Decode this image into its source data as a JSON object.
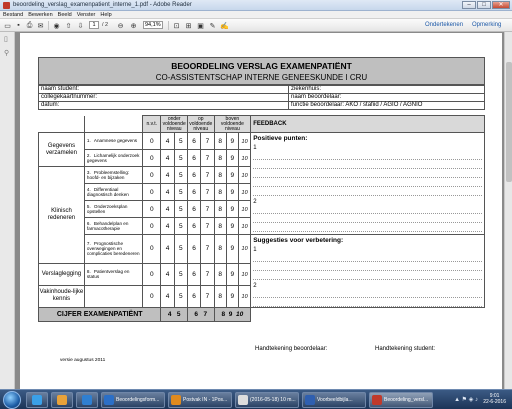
{
  "window": {
    "title": "beoordeling_verslag_examenpatient_interne_1.pdf - Adobe Reader",
    "minimize": "–",
    "maximize": "□",
    "close": "✕"
  },
  "menu": [
    "Bestand",
    "Bewerken",
    "Beeld",
    "Venster",
    "Help"
  ],
  "toolbar": {
    "page_current": "1",
    "page_total": "/ 2",
    "zoom": "94,1%",
    "sign_link": "Ondertekenen",
    "comment_link": "Opmerking"
  },
  "doc": {
    "title": "BEOORDELING VERSLAG EXAMENPATIËNT",
    "subtitle": "CO-ASSISTENTSCHAP INTERNE GENEESKUNDE I CRU",
    "info": [
      {
        "left": "naam student:",
        "right": "ziekenhuis:"
      },
      {
        "left": "collegekaartnummer:",
        "right": "naam beoordelaar:"
      },
      {
        "left": "datum:",
        "right": "functie beoordelaar: AKO / stafiid / AGIO / AGNIO"
      }
    ],
    "headers": {
      "nvt": "n.v.t.",
      "onder": "onder voldoende niveau",
      "op": "op voldoende niveau",
      "boven": "boven voldoende niveau",
      "feedback": "FEEDBACK"
    },
    "score_nvt": "0",
    "score_onder": [
      "4",
      "5"
    ],
    "score_op": [
      "6",
      "7"
    ],
    "score_boven": [
      "8",
      "9",
      "10"
    ],
    "categories": [
      {
        "name": "Gegevens verzamelen",
        "items": [
          {
            "num": "1.",
            "text": "Anamnese gegevens"
          },
          {
            "num": "2.",
            "text": "Lichamelijk onderzoek gegevens"
          }
        ]
      },
      {
        "name": "Klinisch redeneren",
        "items": [
          {
            "num": "3.",
            "text": "Probleemstelling: hoofd- en bijzaken"
          },
          {
            "num": "4.",
            "text": "Differentiaal diagnostisch denken"
          },
          {
            "num": "5.",
            "text": "Onderzoeksplan opstellen"
          },
          {
            "num": "6.",
            "text": "Behandelplan en farmacotherapie"
          },
          {
            "num": "7.",
            "text": "Prognostische overwegingen en complicaties beredeneren"
          }
        ]
      },
      {
        "name": "Verslaglegging",
        "items": [
          {
            "num": "8.",
            "text": "Patientverslag en status"
          }
        ]
      },
      {
        "name": "Vakinhoude-lijke kennis",
        "items": [
          {
            "num": "",
            "text": ""
          }
        ]
      }
    ],
    "feedback": {
      "positive_label": "Positieve punten:",
      "suggestions_label": "Suggesties voor verbetering:",
      "n1": "1",
      "n2": "2"
    },
    "total_label": "CIJFER EXAMENPATIËNT",
    "sig_assessor": "Handtekening beoordelaar:",
    "sig_student": "Handtekening student:",
    "version": "versie augustus 2011"
  },
  "taskbar": {
    "items": [
      {
        "label": "",
        "color": "#3aa0e8"
      },
      {
        "label": "",
        "color": "#e8a23a"
      },
      {
        "label": "",
        "color": "#2f7fd1"
      },
      {
        "label": "Beoordelingsform...",
        "color": "#2b6fc7"
      },
      {
        "label": "Postvak IN - 1Pos...",
        "color": "#e08a1e"
      },
      {
        "label": "(2016-05-18) 10 m...",
        "color": "#dddddd"
      },
      {
        "label": "Voorbeeldbijla...",
        "color": "#2f5fb0"
      },
      {
        "label": "Beoordeling_versl...",
        "color": "#c0392b"
      }
    ],
    "clock_time": "9:01",
    "clock_date": "22-6-2016"
  }
}
